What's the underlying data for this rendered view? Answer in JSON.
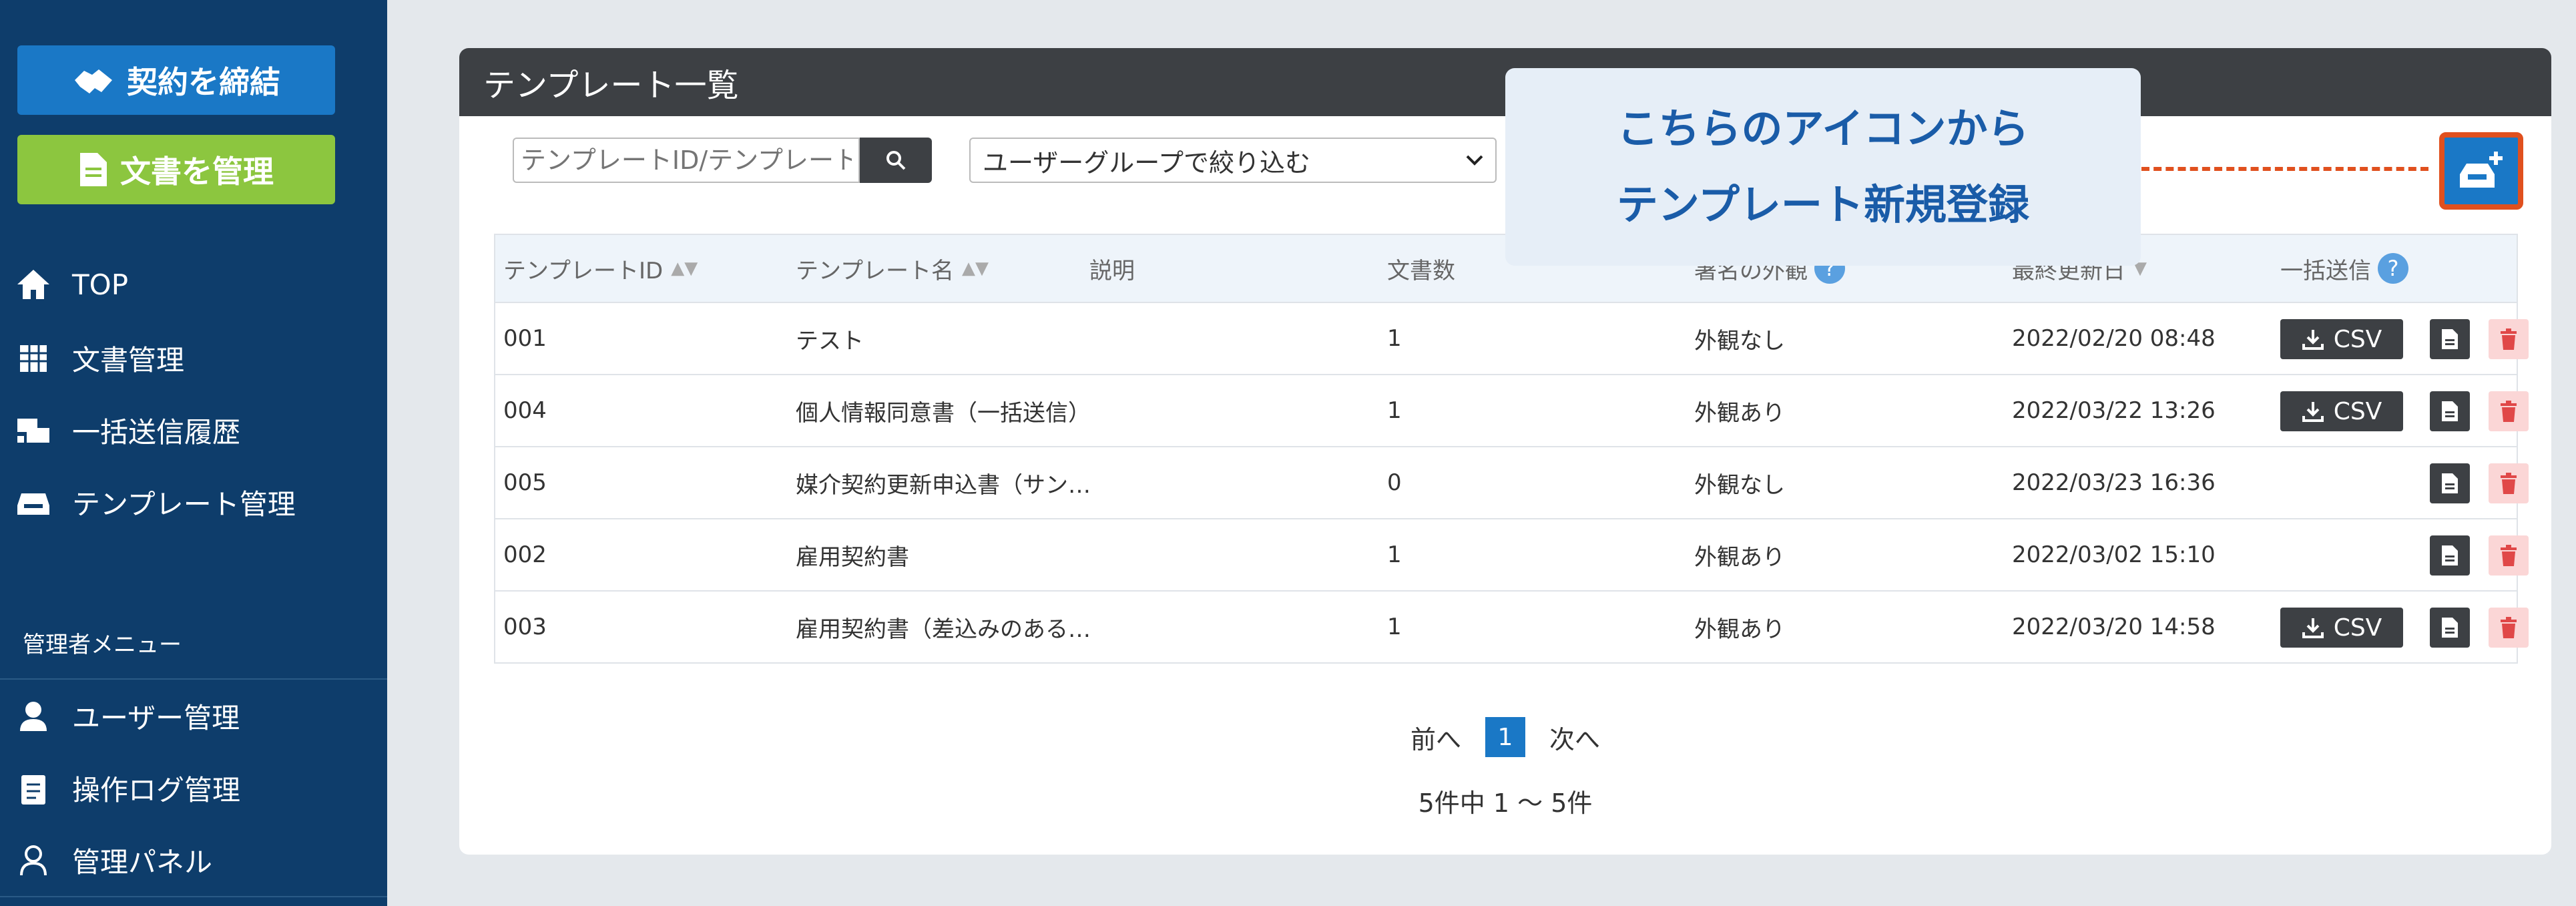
{
  "sidebar": {
    "contract_label": "契約を締結",
    "docs_label": "文書を管理",
    "nav": [
      {
        "label": "TOP"
      },
      {
        "label": "文書管理"
      },
      {
        "label": "一括送信履歴"
      },
      {
        "label": "テンプレート管理"
      }
    ],
    "admin_title": "管理者メニュー",
    "admin_nav": [
      {
        "label": "ユーザー管理"
      },
      {
        "label": "操作ログ管理"
      },
      {
        "label": "管理パネル"
      }
    ]
  },
  "panel": {
    "title": "テンプレート一覧",
    "search_placeholder": "テンプレートID/テンプレート名",
    "group_filter": "ユーザーグループで絞り込む"
  },
  "callout": {
    "line1": "こちらのアイコンから",
    "line2": "テンプレート新規登録"
  },
  "table": {
    "headers": {
      "id": "テンプレートID",
      "name": "テンプレート名",
      "desc": "説明",
      "count": "文書数",
      "appearance": "署名の外観",
      "updated": "最終更新日",
      "bulk": "一括送信"
    },
    "rows": [
      {
        "id": "001",
        "name": "テスト",
        "count": "1",
        "appearance": "外観なし",
        "updated": "2022/02/20 08:48",
        "csv": "CSV"
      },
      {
        "id": "004",
        "name": "個人情報同意書（一括送信）",
        "count": "1",
        "appearance": "外観あり",
        "updated": "2022/03/22 13:26",
        "csv": "CSV"
      },
      {
        "id": "005",
        "name": "媒介契約更新申込書（サン…",
        "count": "0",
        "appearance": "外観なし",
        "updated": "2022/03/23 16:36",
        "csv": ""
      },
      {
        "id": "002",
        "name": "雇用契約書",
        "count": "1",
        "appearance": "外観あり",
        "updated": "2022/03/02 15:10",
        "csv": ""
      },
      {
        "id": "003",
        "name": "雇用契約書（差込みのある…",
        "count": "1",
        "appearance": "外観あり",
        "updated": "2022/03/20 14:58",
        "csv": "CSV"
      }
    ]
  },
  "pagination": {
    "prev": "前へ",
    "current": "1",
    "next": "次へ",
    "summary": "5件中 1 ～ 5件"
  }
}
